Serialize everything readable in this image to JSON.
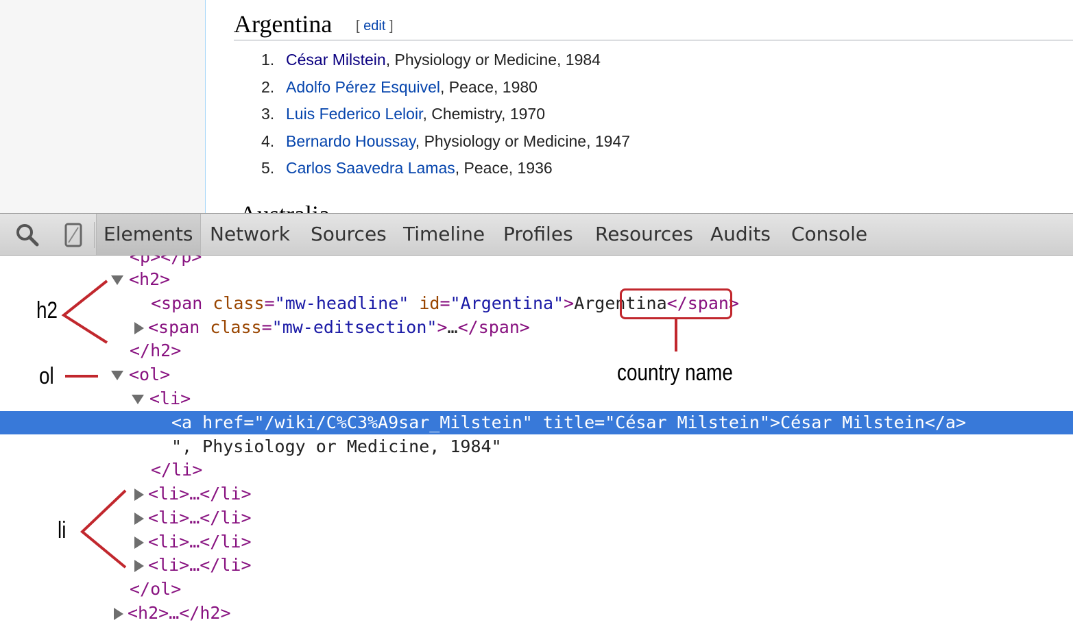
{
  "wiki": {
    "heading": "Argentina",
    "edit_open": "[",
    "edit_label": "edit",
    "edit_close": "]",
    "laureates": [
      {
        "num": "1.",
        "name": "César Milstein",
        "rest": ", Physiology or Medicine, 1984"
      },
      {
        "num": "2.",
        "name": "Adolfo Pérez Esquivel",
        "rest": ", Peace, 1980"
      },
      {
        "num": "3.",
        "name": "Luis Federico Leloir",
        "rest": ", Chemistry, 1970"
      },
      {
        "num": "4.",
        "name": "Bernardo Houssay",
        "rest": ", Physiology or Medicine, 1947"
      },
      {
        "num": "5.",
        "name": "Carlos Saavedra Lamas",
        "rest": ", Peace, 1936"
      }
    ],
    "next_heading_partial": "Australia"
  },
  "devtools": {
    "tabs": [
      "Elements",
      "Network",
      "Sources",
      "Timeline",
      "Profiles",
      "Resources",
      "Audits",
      "Console"
    ],
    "icons": {
      "search": "search-icon",
      "device": "mobile-device-icon"
    }
  },
  "tree": {
    "l0": "<p></p>",
    "l1": "<h2>",
    "l2_open": "<span ",
    "l2_a1": "class",
    "l2_eq1": "=",
    "l2_v1": "\"mw-headline\"",
    "l2_a2": "id",
    "l2_eq2": "=",
    "l2_v2": "\"Argentina\"",
    "l2_gt": ">",
    "l2_text": "Argentina",
    "l2_close": "</span>",
    "l3_open": "<span ",
    "l3_a1": "class",
    "l3_eq1": "=",
    "l3_v1": "\"mw-editsection\"",
    "l3_gt": ">",
    "l3_text": "…",
    "l3_close": "</span>",
    "l4": "</h2>",
    "l5": "<ol>",
    "l6": "<li>",
    "l7_open": "<a ",
    "l7_a1": "href",
    "l7_eq1": "=",
    "l7_v1": "\"/wiki/C%C3%A9sar_Milstein\"",
    "l7_a2": "title",
    "l7_eq2": "=",
    "l7_v2": "\"César Milstein\"",
    "l7_gt": ">",
    "l7_text": "César Milstein",
    "l7_close": "</a>",
    "l8": "\", Physiology or Medicine, 1984\"",
    "l9": "</li>",
    "collapsed_li": "<li>…</li>",
    "l14": "</ol>",
    "l15": "<h2>…</h2>"
  },
  "annotations": {
    "h2": "h2",
    "ol": "ol",
    "li": "li",
    "country_name": "country name",
    "color": "#c1272d"
  }
}
